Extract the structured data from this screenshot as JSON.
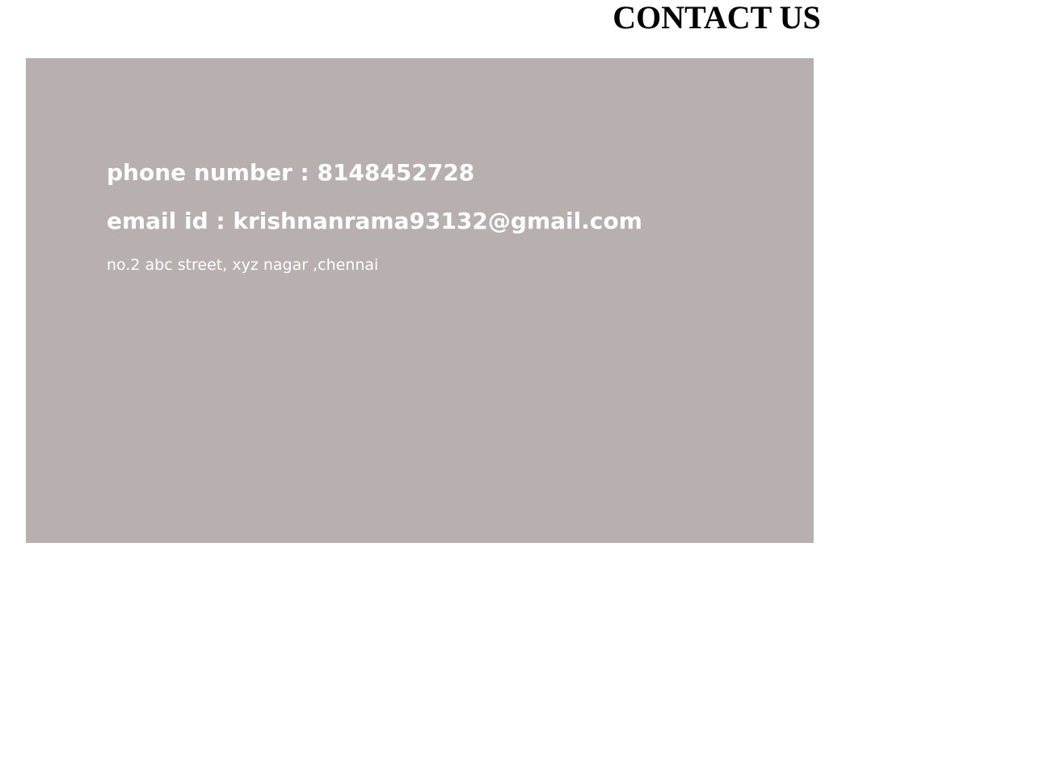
{
  "page": {
    "title": "CONTACT US"
  },
  "contact": {
    "phone": "phone number : 8148452728",
    "email": "email id : krishnanrama93132@gmail.com",
    "address": "no.2 abc street, xyz nagar ,chennai"
  },
  "colors": {
    "card_background": "#b8b0ae",
    "card_text": "#ffffff",
    "title_text": "#000000",
    "page_background": "#ffffff"
  }
}
